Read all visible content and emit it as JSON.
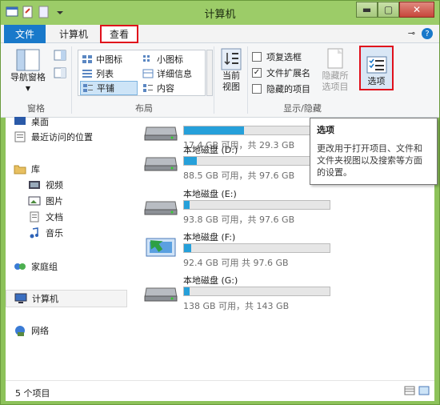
{
  "window": {
    "title": "计算机"
  },
  "tabs": {
    "file": "文件",
    "computer": "计算机",
    "view": "查看"
  },
  "ribbon": {
    "pane": {
      "nav_pane": "导航窗格",
      "group": "窗格"
    },
    "layout": {
      "group": "布局",
      "items": [
        "中图标",
        "小图标",
        "列表",
        "详细信息",
        "平铺",
        "内容"
      ]
    },
    "current_view": {
      "label_line1": "当前",
      "label_line2": "视图"
    },
    "show_hide": {
      "group": "显示/隐藏",
      "item_checkboxes": "项复选框",
      "file_extensions": "文件扩展名",
      "hidden_items": "隐藏的项目",
      "hide_selected_line1": "隐藏所",
      "hide_selected_line2": "选项目"
    },
    "options": {
      "label": "选项"
    }
  },
  "nav": {
    "desktop": "桌面",
    "recent": "最近访问的位置",
    "libraries": "库",
    "videos": "视频",
    "pictures": "图片",
    "documents": "文档",
    "music": "音乐",
    "homegroup": "家庭组",
    "computer": "计算机",
    "network": "网络"
  },
  "drives": [
    {
      "name": "",
      "info": "17.4 GB 可用，共 29.3 GB",
      "used_fraction": 0.41
    },
    {
      "name": "本地磁盘 (D:)",
      "info": "88.5 GB 可用，共 97.6 GB",
      "used_fraction": 0.09
    },
    {
      "name": "本地磁盘 (E:)",
      "info": "93.8 GB 可用，共 97.6 GB",
      "used_fraction": 0.04
    },
    {
      "name": "本地磁盘 (F:)",
      "info": "92.4 GB 可用     共 97.6 GB",
      "used_fraction": 0.05
    },
    {
      "name": "本地磁盘 (G:)",
      "info": "138 GB 可用，共 143 GB",
      "used_fraction": 0.04
    }
  ],
  "tooltip": {
    "title": "选项",
    "body": "更改用于打开项目、文件和文件夹视图以及搜索等方面的设置。"
  },
  "status": {
    "count": "5 个项目"
  }
}
